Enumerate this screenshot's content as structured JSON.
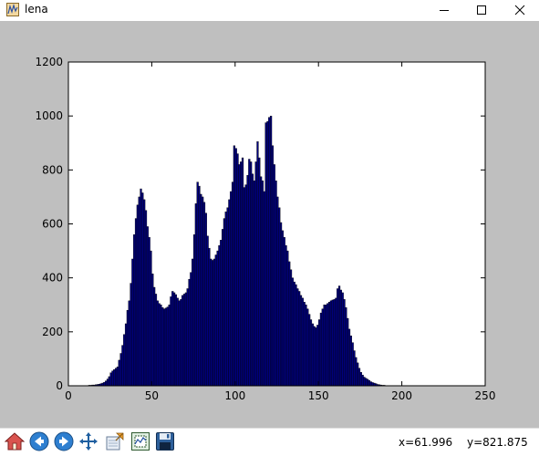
{
  "window": {
    "title": "lena",
    "icon": "matplotlib-figure-icon",
    "buttons": [
      "minimize-icon",
      "maximize-icon",
      "close-icon"
    ]
  },
  "colors": {
    "figure_bg": "#bfbfbf",
    "axes_bg": "#ffffff",
    "bar_fill": "#00007f",
    "bar_edge": "#000000"
  },
  "toolbar": {
    "buttons": [
      "home-icon",
      "back-icon",
      "forward-icon",
      "pan-icon",
      "zoom-icon",
      "configure-subplots-icon",
      "save-icon"
    ],
    "coord_x": "x=61.996",
    "coord_y": "y=821.875"
  },
  "chart_data": {
    "type": "bar",
    "title": "",
    "xlabel": "",
    "ylabel": "",
    "xlim": [
      0,
      250
    ],
    "ylim": [
      0,
      1200
    ],
    "x_ticks": [
      0,
      50,
      100,
      150,
      200,
      250
    ],
    "y_ticks": [
      0,
      200,
      400,
      600,
      800,
      1000,
      1200
    ],
    "grid": false,
    "bar_width": 1,
    "x": [
      12,
      13,
      14,
      15,
      16,
      17,
      18,
      19,
      20,
      21,
      22,
      23,
      24,
      25,
      26,
      27,
      28,
      29,
      30,
      31,
      32,
      33,
      34,
      35,
      36,
      37,
      38,
      39,
      40,
      41,
      42,
      43,
      44,
      45,
      46,
      47,
      48,
      49,
      50,
      51,
      52,
      53,
      54,
      55,
      56,
      57,
      58,
      59,
      60,
      61,
      62,
      63,
      64,
      65,
      66,
      67,
      68,
      69,
      70,
      71,
      72,
      73,
      74,
      75,
      76,
      77,
      78,
      79,
      80,
      81,
      82,
      83,
      84,
      85,
      86,
      87,
      88,
      89,
      90,
      91,
      92,
      93,
      94,
      95,
      96,
      97,
      98,
      99,
      100,
      101,
      102,
      103,
      104,
      105,
      106,
      107,
      108,
      109,
      110,
      111,
      112,
      113,
      114,
      115,
      116,
      117,
      118,
      119,
      120,
      121,
      122,
      123,
      124,
      125,
      126,
      127,
      128,
      129,
      130,
      131,
      132,
      133,
      134,
      135,
      136,
      137,
      138,
      139,
      140,
      141,
      142,
      143,
      144,
      145,
      146,
      147,
      148,
      149,
      150,
      151,
      152,
      153,
      154,
      155,
      156,
      157,
      158,
      159,
      160,
      161,
      162,
      163,
      164,
      165,
      166,
      167,
      168,
      169,
      170,
      171,
      172,
      173,
      174,
      175,
      176,
      177,
      178,
      179,
      180,
      181,
      182,
      183,
      184,
      185,
      186,
      187,
      188,
      189,
      190,
      191,
      192,
      193,
      194,
      195,
      196,
      197,
      198,
      199,
      200,
      201,
      202,
      203,
      204,
      205,
      206,
      207,
      208,
      209,
      210,
      211,
      212,
      213,
      214,
      215,
      216,
      217,
      218,
      219,
      220,
      221,
      222,
      223,
      224,
      225,
      226,
      227,
      228,
      229,
      230,
      231,
      232,
      233,
      234,
      235,
      236,
      237,
      238,
      239,
      240,
      241,
      242
    ],
    "values": [
      2,
      2,
      3,
      3,
      4,
      5,
      6,
      8,
      10,
      13,
      18,
      25,
      34,
      48,
      55,
      60,
      65,
      70,
      95,
      120,
      150,
      190,
      230,
      280,
      315,
      380,
      470,
      560,
      620,
      670,
      700,
      730,
      715,
      690,
      650,
      590,
      550,
      500,
      415,
      365,
      340,
      315,
      305,
      300,
      290,
      285,
      288,
      292,
      300,
      330,
      350,
      345,
      338,
      325,
      315,
      320,
      335,
      340,
      345,
      360,
      395,
      420,
      470,
      560,
      675,
      755,
      740,
      710,
      700,
      680,
      640,
      555,
      510,
      470,
      465,
      470,
      485,
      500,
      520,
      540,
      580,
      620,
      645,
      660,
      690,
      720,
      755,
      890,
      880,
      860,
      820,
      830,
      845,
      735,
      745,
      780,
      840,
      830,
      785,
      760,
      830,
      905,
      845,
      775,
      760,
      720,
      975,
      980,
      995,
      1000,
      890,
      820,
      760,
      700,
      660,
      605,
      575,
      550,
      520,
      500,
      460,
      430,
      400,
      385,
      375,
      360,
      350,
      335,
      325,
      310,
      300,
      285,
      265,
      245,
      230,
      220,
      215,
      225,
      245,
      270,
      285,
      300,
      300,
      305,
      310,
      315,
      318,
      320,
      325,
      360,
      370,
      355,
      345,
      320,
      290,
      250,
      210,
      185,
      160,
      130,
      105,
      85,
      65,
      50,
      40,
      32,
      28,
      24,
      20,
      15,
      12,
      10,
      8,
      5,
      4,
      3,
      2,
      2,
      1,
      1
    ]
  }
}
